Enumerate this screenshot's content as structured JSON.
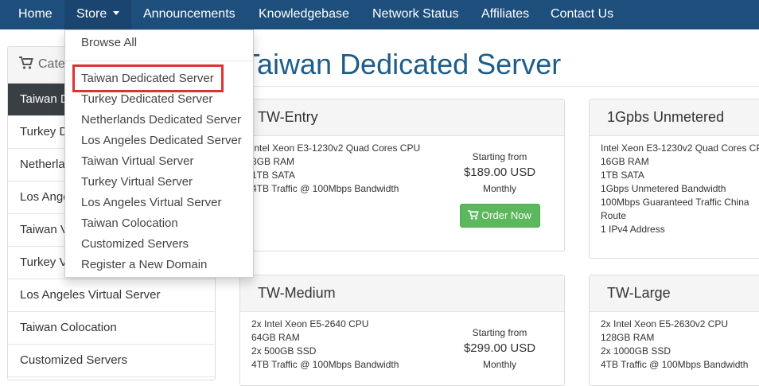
{
  "navbar": {
    "items": [
      {
        "label": "Home"
      },
      {
        "label": "Store"
      },
      {
        "label": "Announcements"
      },
      {
        "label": "Knowledgebase"
      },
      {
        "label": "Network Status"
      },
      {
        "label": "Affiliates"
      },
      {
        "label": "Contact Us"
      }
    ]
  },
  "dropdown": {
    "browse_all": "Browse All",
    "items": [
      {
        "label": "Taiwan Dedicated Server"
      },
      {
        "label": "Turkey Dedicated Server"
      },
      {
        "label": "Netherlands Dedicated Server"
      },
      {
        "label": "Los Angeles Dedicated Server"
      },
      {
        "label": "Taiwan Virtual Server"
      },
      {
        "label": "Turkey Virtual Server"
      },
      {
        "label": "Los Angeles Virtual Server"
      },
      {
        "label": "Taiwan Colocation"
      },
      {
        "label": "Customized Servers"
      },
      {
        "label": "Register a New Domain"
      }
    ]
  },
  "sidebar": {
    "heading": "Cate",
    "items": [
      {
        "label": "Taiwan D"
      },
      {
        "label": "Turkey De"
      },
      {
        "label": "Netherlan"
      },
      {
        "label": "Los Angele"
      },
      {
        "label": "Taiwan Vi"
      },
      {
        "label": "Turkey Vi"
      },
      {
        "label": "Los Angeles Virtual Server"
      },
      {
        "label": "Taiwan Colocation"
      },
      {
        "label": "Customized Servers"
      }
    ]
  },
  "page": {
    "title": "Taiwan Dedicated Server"
  },
  "products": [
    {
      "name": "TW-Entry",
      "features": [
        "Intel Xeon E3-1230v2 Quad Cores CPU",
        "8GB RAM",
        "1TB SATA",
        "4TB Traffic @ 100Mbps Bandwidth"
      ],
      "starting_from": "Starting from",
      "price": "$189.00 USD",
      "cycle": "Monthly",
      "order_label": "Order Now"
    },
    {
      "name": "1Gpbs Unmetered",
      "features": [
        "Intel Xeon E3-1230v2 Quad Cores CP",
        "16GB RAM",
        "1TB SATA",
        "1Gbps Unmetered Bandwidth",
        "100Mbps Guaranteed Traffic China",
        "Route",
        "1 IPv4 Address"
      ]
    },
    {
      "name": "TW-Medium",
      "features": [
        "2x Intel Xeon E5-2640 CPU",
        "64GB RAM",
        "2x 500GB SSD",
        "4TB Traffic @ 100Mbps Bandwidth"
      ],
      "starting_from": "Starting from",
      "price": "$299.00 USD",
      "cycle": "Monthly"
    },
    {
      "name": "TW-Large",
      "features": [
        "2x Intel Xeon E5-2630v2 CPU",
        "128GB RAM",
        "2x 1000GB SSD",
        "4TB Traffic @ 100Mbps Bandwidth"
      ]
    }
  ],
  "colors": {
    "navbar": "#1d4e7c",
    "title": "#1d5d8a",
    "order_button": "#5cb85c",
    "highlight": "#e03131",
    "sidebar_active": "#3a3f44"
  }
}
